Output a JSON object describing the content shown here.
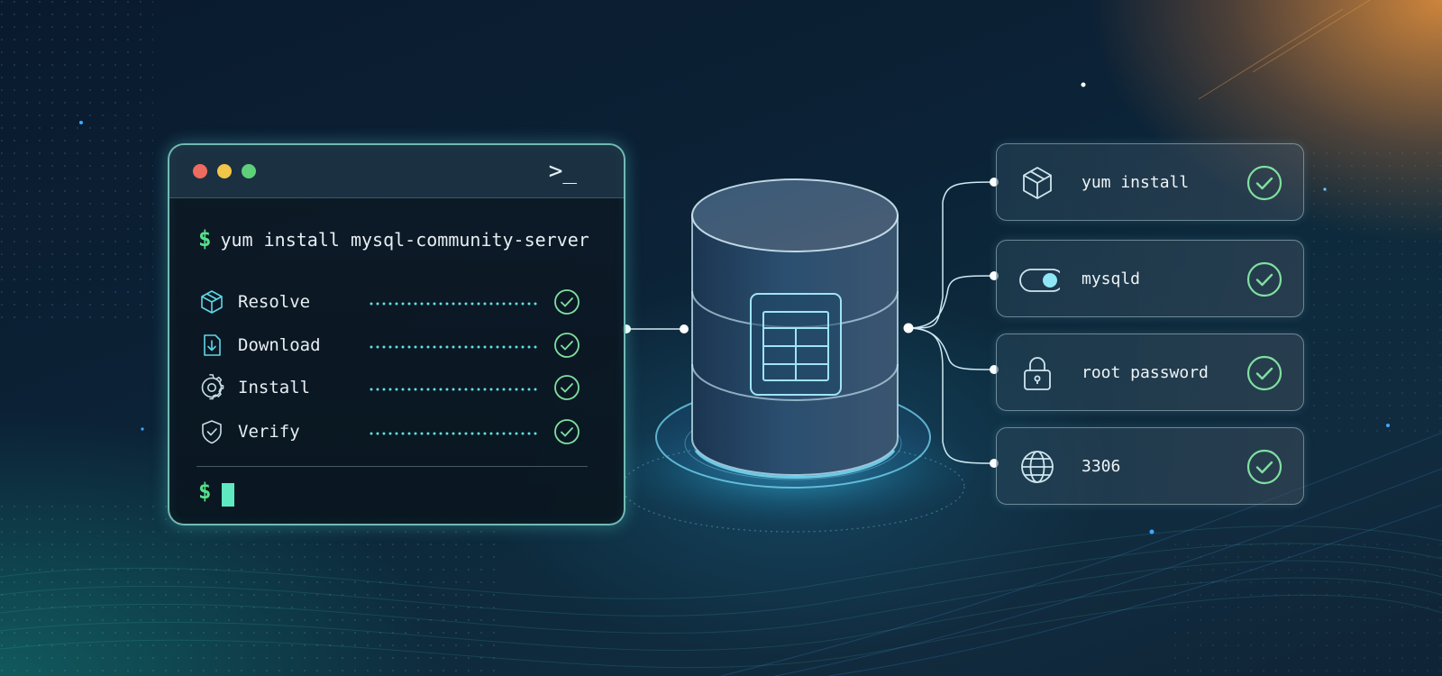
{
  "terminal": {
    "prompt_symbol": "$",
    "prompt_icon": ">_",
    "command": "yum install mysql-community-server",
    "steps": [
      {
        "label": "Resolve",
        "icon": "package-icon",
        "status": "done"
      },
      {
        "label": "Download",
        "icon": "download-icon",
        "status": "done"
      },
      {
        "label": "Install",
        "icon": "gear-icon",
        "status": "done"
      },
      {
        "label": "Verify",
        "icon": "shield-check-icon",
        "status": "done"
      }
    ]
  },
  "database": {
    "icon": "database-cylinder-icon",
    "emblem": "table-grid-icon"
  },
  "cards": [
    {
      "label": "yum install",
      "icon": "package-icon",
      "status": "done"
    },
    {
      "label": "mysqld",
      "icon": "toggle-switch-icon",
      "status": "done"
    },
    {
      "label": "root password",
      "icon": "lock-icon",
      "status": "done"
    },
    {
      "label": "3306",
      "icon": "globe-icon",
      "status": "done"
    }
  ],
  "colors": {
    "accent_teal": "#5fe9d6",
    "check_green": "#7fe0a0",
    "prompt_green": "#57e08a",
    "glow_orange": "#f0963c"
  }
}
